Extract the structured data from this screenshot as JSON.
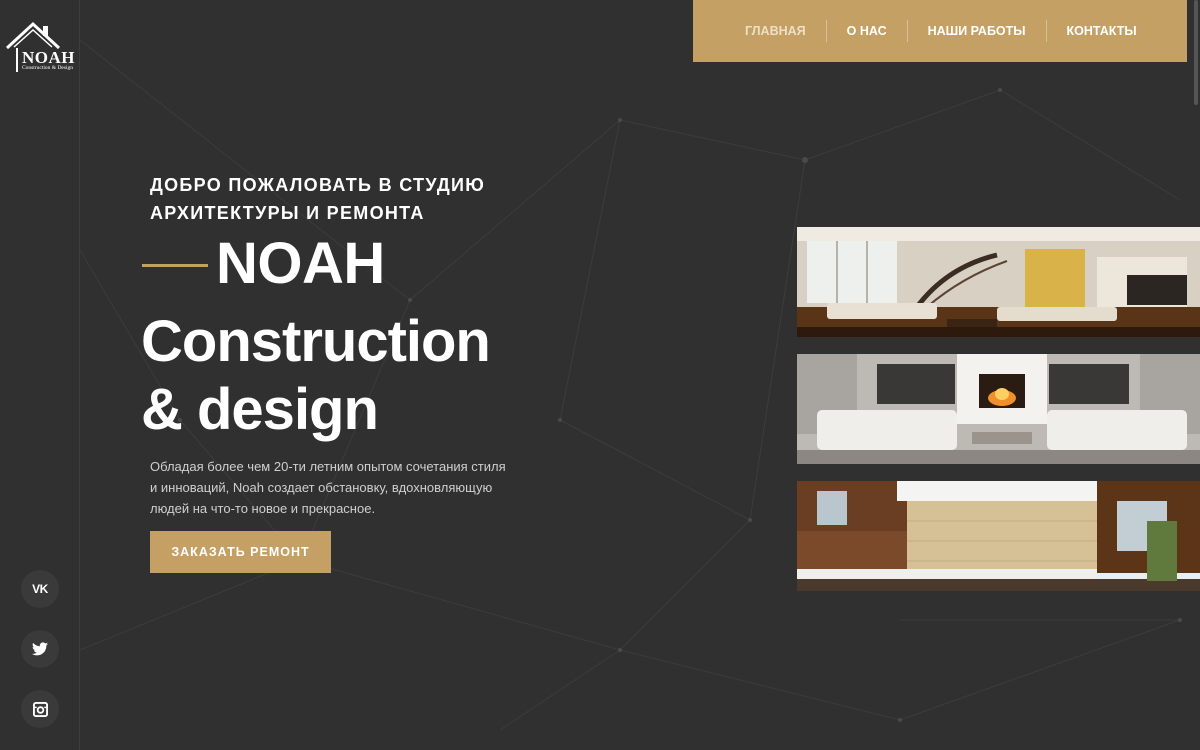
{
  "logo": {
    "brand": "NOAH",
    "subtitle": "Construction & Design"
  },
  "nav": {
    "items": [
      "ГЛАВНАЯ",
      "О НАС",
      "НАШИ РАБОТЫ",
      "КОНТАКТЫ"
    ],
    "active_index": 0
  },
  "hero": {
    "tagline_line1": "ДОБРО ПОЖАЛОВАТЬ В СТУДИЮ",
    "tagline_line2": "АРХИТЕКТУРЫ И РЕМОНТА",
    "title_line1": "NOAH",
    "title_line2": "Construction",
    "title_line3": "& design",
    "description": "Обладая более чем 20-ти летним опытом сочетания стиля и инноваций, Noah создает обстановку, вдохновляющую людей на что-то новое и прекрасное.",
    "cta_label": "ЗАКАЗАТЬ РЕМОНТ"
  },
  "social": [
    {
      "icon": "vk-icon",
      "glyph": "VK"
    },
    {
      "icon": "twitter-icon"
    },
    {
      "icon": "instagram-icon"
    }
  ],
  "gallery": [
    {
      "subject": "living room with spiral staircase"
    },
    {
      "subject": "white living room with fireplace"
    },
    {
      "subject": "modern house exterior"
    }
  ],
  "colors": {
    "background": "#303030",
    "accent": "#c4a064",
    "text": "#ffffff",
    "muted_text": "#cfcfcf"
  }
}
